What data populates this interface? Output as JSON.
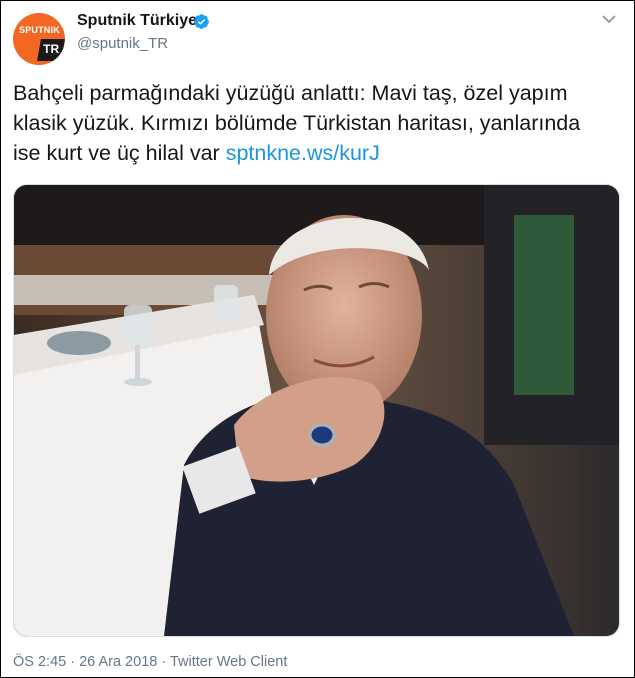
{
  "account": {
    "name": "Sputnik Türkiye",
    "handle": "@sputnik_TR",
    "avatar_logo_text": "SPUTNIK",
    "avatar_badge_text": "TR"
  },
  "tweet": {
    "text": "Bahçeli parmağındaki yüzüğü anlattı: Mavi taş, özel yapım klasik yüzük. Kırmızı bölümde Türkistan haritası, yanlarında ise kurt ve üç hilal var",
    "link": "sptnkne.ws/kurJ"
  },
  "meta": {
    "time": "ÖS 2:45",
    "separator1": "·",
    "date": "26 Ara 2018",
    "separator2": "·",
    "client": "Twitter Web Client"
  },
  "colors": {
    "link": "#1b95e0",
    "verified": "#1da1f2",
    "avatar_bg": "#f26722",
    "muted": "#657786"
  }
}
